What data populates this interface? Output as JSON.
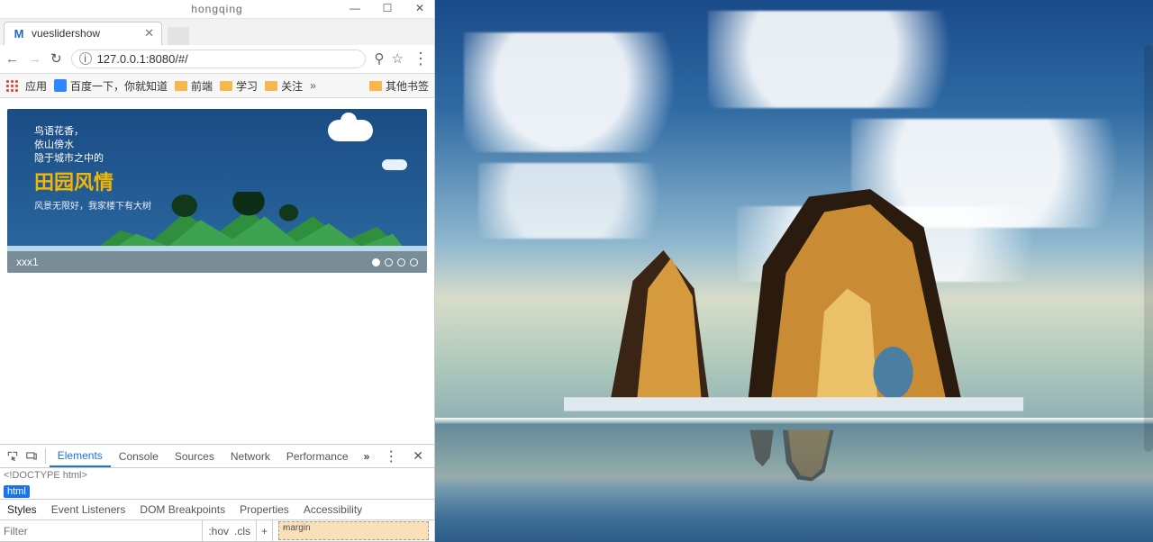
{
  "os": {
    "title": "hongqing",
    "controls": {
      "min": "—",
      "max": "☐",
      "close": "✕"
    }
  },
  "browser": {
    "tab": {
      "favicon_letter": "M",
      "title": "vueslidershow",
      "close": "✕"
    },
    "nav": {
      "back": "←",
      "forward": "→",
      "reload": "↻"
    },
    "addr": {
      "badge": "i",
      "url": "127.0.0.1:8080/#/"
    },
    "addr_actions": {
      "search": "⚲",
      "star": "☆"
    },
    "more": "⋮",
    "bookmarks": {
      "apps": "应用",
      "items": [
        {
          "icon": "baidu",
          "label": "百度一下，你就知道"
        },
        {
          "icon": "folder",
          "label": "前端"
        },
        {
          "icon": "folder",
          "label": "学习"
        },
        {
          "icon": "folder",
          "label": "关注"
        }
      ],
      "overflow": "»",
      "other": {
        "icon": "folder",
        "label": "其他书签"
      }
    }
  },
  "banner": {
    "line1": "鸟语花香，",
    "line2": "依山傍水",
    "line3": "隐于城市之中的",
    "title": "田园风情",
    "subtitle": "风景无限好，我家楼下有大树",
    "caption": "xxx1",
    "dot_count": 4,
    "active_dot": 0
  },
  "devtools": {
    "tabs": [
      "Elements",
      "Console",
      "Sources",
      "Network",
      "Performance"
    ],
    "active_tab": "Elements",
    "overflow": "»",
    "more": "⋮",
    "close": "✕",
    "dom_preview": "<!DOCTYPE html>",
    "path_badge": "html",
    "style_tabs": [
      "Styles",
      "Event Listeners",
      "DOM Breakpoints",
      "Properties",
      "Accessibility"
    ],
    "active_style_tab": "Styles",
    "filter_placeholder": "Filter",
    "hov": ":hov",
    "cls": ".cls",
    "plus": "+",
    "boxmodel_label": "margin",
    "boxmodel_dash": "-"
  }
}
